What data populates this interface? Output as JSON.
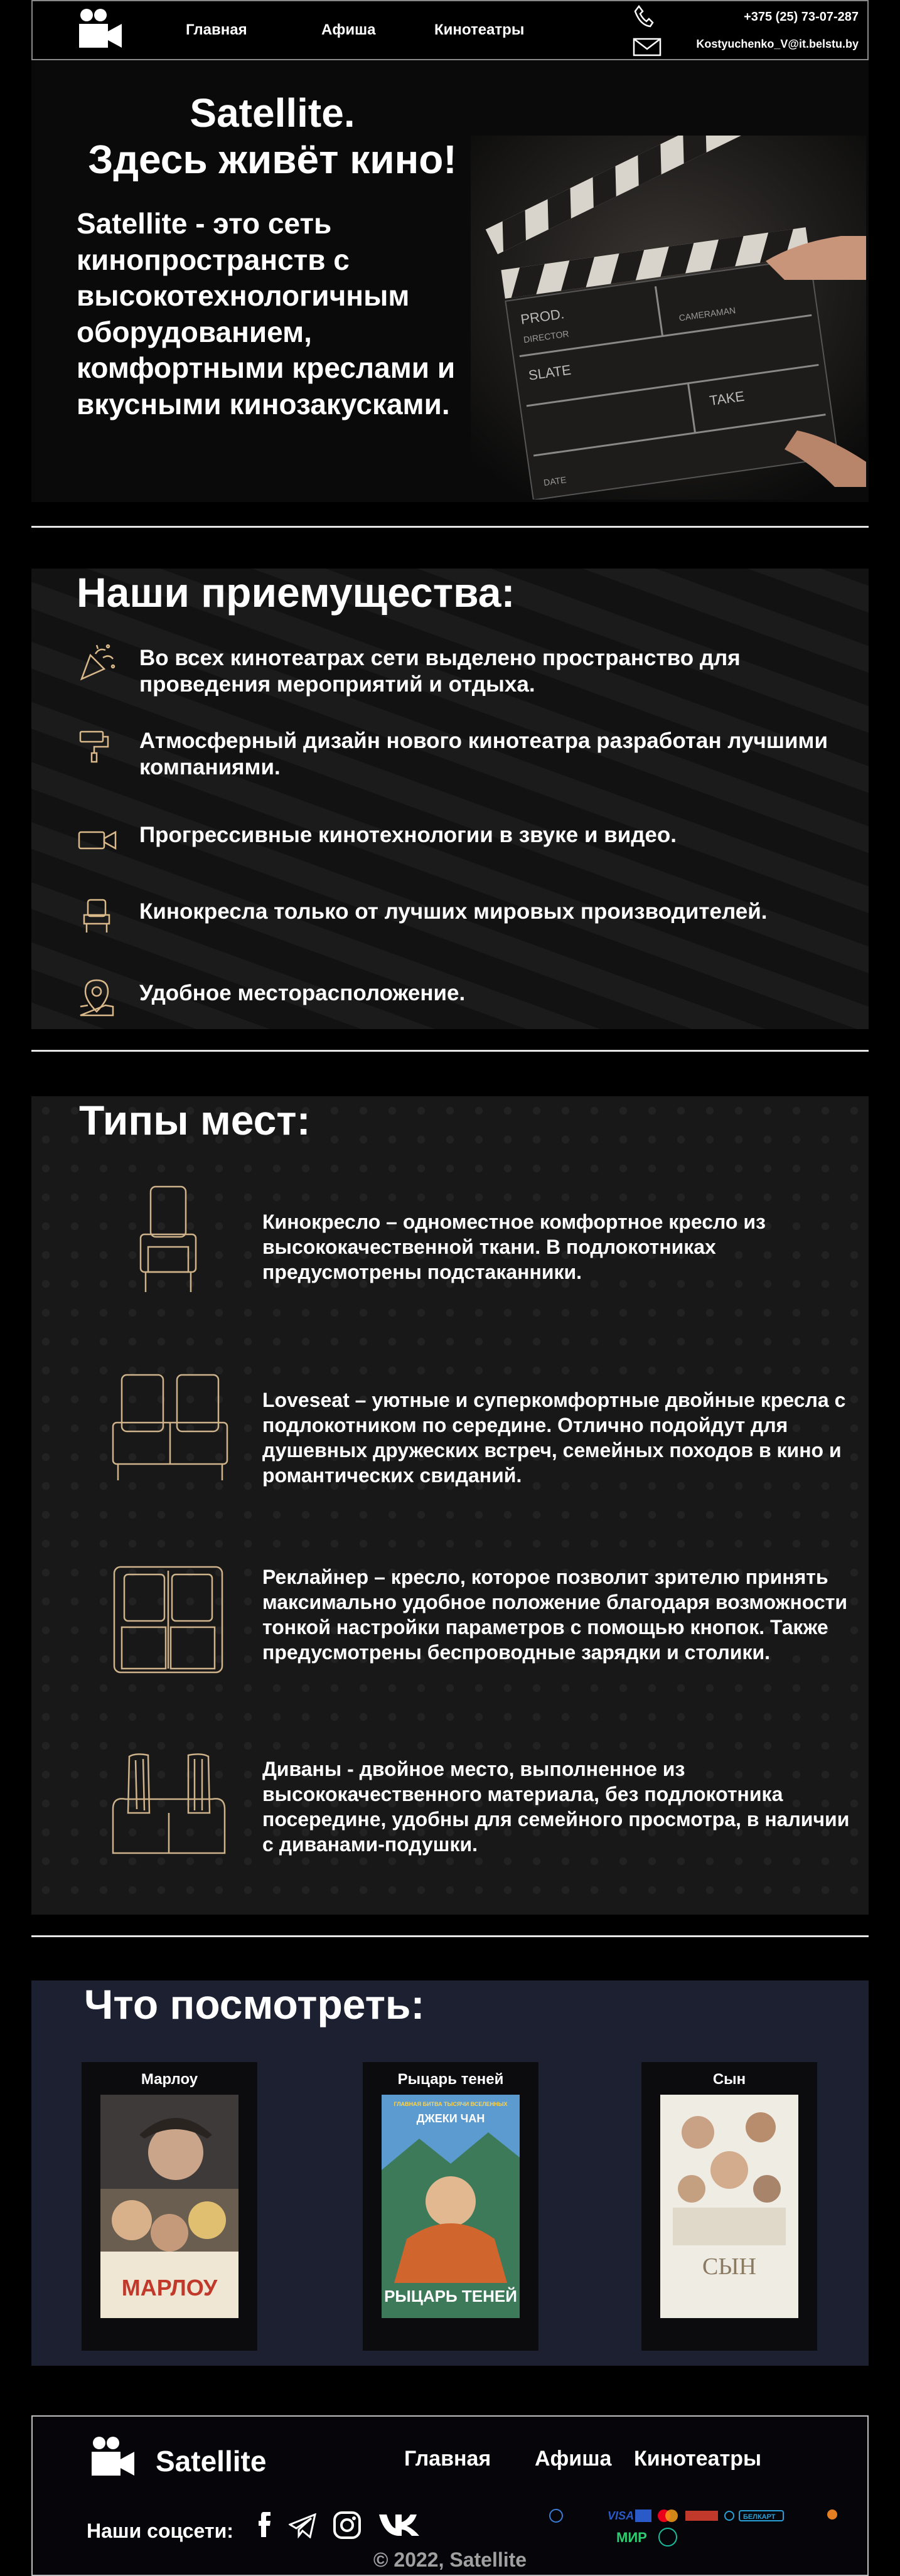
{
  "header": {
    "nav": [
      "Главная",
      "Афиша",
      "Кинотеатры"
    ],
    "phone": "+375 (25) 73-07-287",
    "email": "Kostyuchenko_V@it.belstu.by"
  },
  "hero": {
    "title_line1": "Satellite.",
    "title_line2": "Здесь живёт кино!",
    "subtitle": "Satellite - это сеть кинопространств с высокотехнологичным оборудованием, комфортными креслами и вкусными кинозакусками.",
    "clapper_words": [
      "PROD.",
      "DIRECTOR",
      "CAMERAMAN",
      "SLATE",
      "TAKE",
      "DATE"
    ]
  },
  "advantages": {
    "title": "Наши приемущества:",
    "items": [
      {
        "icon": "confetti-icon",
        "text": "Во всех кинотеатрах сети выделено пространство для проведения мероприятий и отдыха."
      },
      {
        "icon": "paint-roller-icon",
        "text": "Атмосферный дизайн нового кинотеатра разработан лучшими компаниями."
      },
      {
        "icon": "video-camera-icon",
        "text": "Прогрессивные кинотехнологии в звуке и видео."
      },
      {
        "icon": "armchair-icon",
        "text": "Кинокресла только от лучших мировых производителей."
      },
      {
        "icon": "location-pin-icon",
        "text": "Удобное месторасположение."
      }
    ]
  },
  "seats": {
    "title": "Типы мест:",
    "items": [
      {
        "icon": "single-seat-icon",
        "text": "Кинокресло – одноместное комфортное кресло из высококачественной ткани. В подлокотниках предусмотрены подстаканники."
      },
      {
        "icon": "loveseat-icon",
        "text": "Loveseat – уютные и суперкомфортные двойные кресла с подлокотником по середине. Отлично подойдут для душевных дружеских встреч, семейных походов в кино и романтических свиданий."
      },
      {
        "icon": "recliner-icon",
        "text": "Реклайнер – кресло, которое позволит зрителю принять максимально удобное положение благодаря возможности тонкой настройки параметров с помощью кнопок. Также предусмотрены беспроводные зарядки и столики."
      },
      {
        "icon": "sofa-icon",
        "text": "Диваны - двойное место, выполненное из высококачественного материала, без подлокотника посередине, удобны для семейного просмотра, в наличии с диванами-подушки."
      }
    ]
  },
  "movies": {
    "title": "Что посмотреть:",
    "items": [
      {
        "title": "Марлоу",
        "poster_text": "МАРЛОУ",
        "poster_top": "",
        "colors": [
          "#c9c2b2",
          "#5a4a3a"
        ]
      },
      {
        "title": "Рыцарь теней",
        "poster_text": "РЫЦАРЬ ТЕНЕЙ",
        "poster_top": "ДЖЕКИ ЧАН",
        "poster_tagline": "ГЛАВНАЯ БИТВА ТЫСЯЧИ ВСЕЛЕННЫХ",
        "colors": [
          "#7fb6e0",
          "#2b6a9a"
        ]
      },
      {
        "title": "Сын",
        "poster_text": "СЫН",
        "poster_top": "",
        "colors": [
          "#efece4",
          "#b8a98c"
        ]
      }
    ]
  },
  "footer": {
    "brand": "Satellite",
    "nav": [
      "Главная",
      "Афиша",
      "Кинотеатры"
    ],
    "social_label": "Наши соцсети:",
    "payments": [
      "VISA",
      "МИР",
      "БЕЛКАРТ"
    ],
    "copyright": "© 2022, Satellite"
  }
}
